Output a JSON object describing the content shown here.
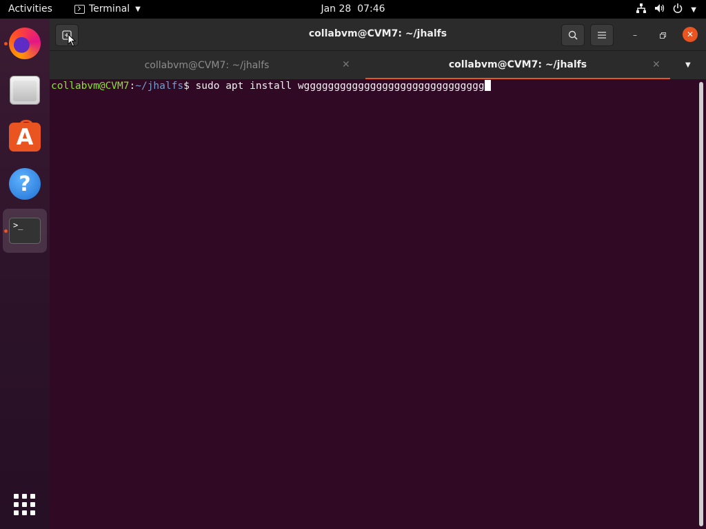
{
  "topbar": {
    "activities": "Activities",
    "app_name": "Terminal",
    "date": "Jan 28",
    "time": "07:46"
  },
  "dock": {
    "items": [
      {
        "name": "firefox",
        "icon": "firefox-icon",
        "running": true
      },
      {
        "name": "files",
        "icon": "files-icon",
        "running": false
      },
      {
        "name": "ubuntu-software",
        "icon": "software-store-icon",
        "running": false
      },
      {
        "name": "help",
        "icon": "help-icon",
        "running": false
      },
      {
        "name": "terminal",
        "icon": "terminal-icon",
        "running": true,
        "active": true
      }
    ],
    "terminal_glyph": ">_",
    "help_glyph": "?",
    "store_glyph": "A"
  },
  "window": {
    "title": "collabvm@CVM7: ~/jhalfs",
    "tabs": [
      {
        "label": "collabvm@CVM7: ~/jhalfs",
        "active": false
      },
      {
        "label": "collabvm@CVM7: ~/jhalfs",
        "active": true
      }
    ]
  },
  "terminal": {
    "prompt_user": "collabvm@CVM7",
    "prompt_sep": ":",
    "prompt_path": "~/jhalfs",
    "prompt_symbol": "$ ",
    "command": "sudo apt install wgggggggggggggggggggggggggggggg"
  },
  "colors": {
    "accent": "#e95420",
    "terminal_bg": "#300a24",
    "prompt_user": "#8ae234",
    "prompt_path": "#729fcf"
  }
}
